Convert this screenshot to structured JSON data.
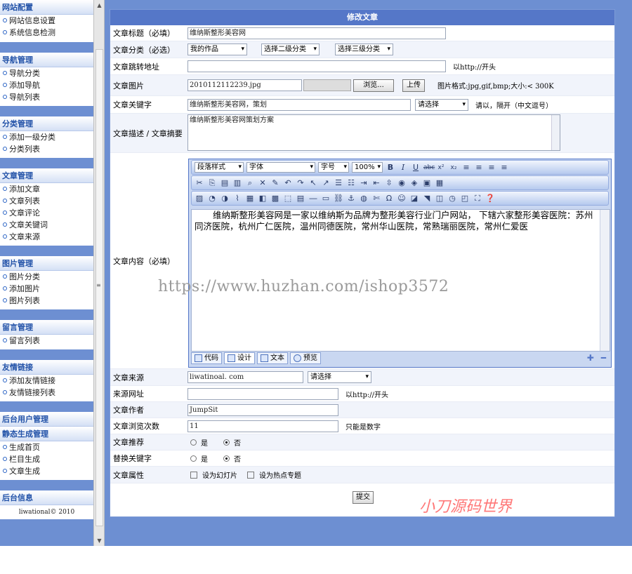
{
  "sidebar": {
    "groups": [
      {
        "title": "网站配置",
        "items": [
          "网站信息设置",
          "系统信息检测"
        ]
      },
      {
        "title": "导航管理",
        "items": [
          "导航分类",
          "添加导航",
          "导航列表"
        ]
      },
      {
        "title": "分类管理",
        "items": [
          "添加一级分类",
          "分类列表"
        ]
      },
      {
        "title": "文章管理",
        "items": [
          "添加文章",
          "文章列表",
          "文章评论",
          "文章关键词",
          "文章来源"
        ]
      },
      {
        "title": "图片管理",
        "items": [
          "图片分类",
          "添加图片",
          "图片列表"
        ]
      },
      {
        "title": "留言管理",
        "items": [
          "留言列表"
        ]
      },
      {
        "title": "友情链接",
        "items": [
          "添加友情链接",
          "友情链接列表"
        ]
      },
      {
        "title": "后台用户管理",
        "items": []
      },
      {
        "title": "静态生成管理",
        "items": [
          "生成首页",
          "栏目生成",
          "文章生成"
        ]
      },
      {
        "title": "后台信息",
        "items": []
      }
    ],
    "copyright": "liwational© 2010"
  },
  "form": {
    "panel_title": "修改文章",
    "title_label": "文章标题（必填）",
    "title_value": "维纳斯整形美容网",
    "category_label": "文章分类（必选）",
    "category_1": "我的作品",
    "category_2": "选择二级分类",
    "category_3": "选择三级分类",
    "redirect_label": "文章跳转地址",
    "redirect_value": "",
    "redirect_hint": "以http://开头",
    "image_label": "文章图片",
    "image_value": "2010112112239.jpg",
    "browse_label": "浏览...",
    "upload_label": "上传",
    "image_hint": "图片格式:jpg,gif,bmp;大小:< 300K",
    "keywords_label": "文章关键字",
    "keywords_value": "维纳斯整形美容网，策划",
    "keywords_select": "请选择",
    "keywords_hint": "请以，隔开（中文逗号）",
    "desc_label": "文章描述 / 文章摘要",
    "desc_value": "维纳斯整形美容网策划方案",
    "content_label": "文章内容（必填）",
    "content_text": "维纳斯整形美容网是一家以维纳斯为品牌为整形美容行业门户网站， 下辖六家整形美容医院：苏州同济医院，杭州广仁医院，温州同德医院，常州华山医院，常熟瑞丽医院，常州仁爱医",
    "source_label": "文章来源",
    "source_value": "liwatinoal. com",
    "source_select": "请选择",
    "source_url_label": "来源网址",
    "source_url_value": "",
    "source_url_hint": "以http://开头",
    "author_label": "文章作者",
    "author_value": "JumpSit",
    "views_label": "文章浏览次数",
    "views_value": "11",
    "views_hint": "只能是数字",
    "recommend_label": "文章推荐",
    "replace_kw_label": "替换关键字",
    "yes": "是",
    "no": "否",
    "attr_label": "文章属性",
    "attr_slide": "设为幻灯片",
    "attr_topic": "设为热点专题",
    "submit_label": "提交"
  },
  "editor": {
    "paragraph_style": "段落样式",
    "font": "字体",
    "size": "字号",
    "zoom": "100%",
    "mode_code": "代码",
    "mode_design": "设计",
    "mode_text": "文本",
    "mode_preview": "预览"
  },
  "overlays": {
    "watermark": "https://www.huzhan.com/ishop3572",
    "brand": "小刀源码世界"
  },
  "colors": {
    "accent": "#5577c8",
    "background": "#6d8fd2",
    "sidebar_title": "#2252a8",
    "brand": "#ff7777"
  }
}
